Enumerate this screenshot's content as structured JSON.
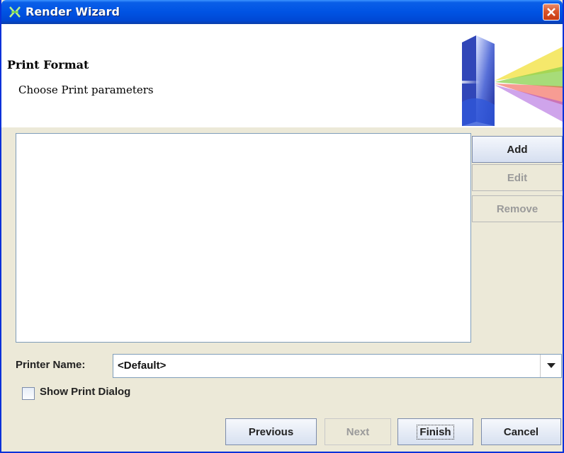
{
  "window": {
    "title": "Render Wizard"
  },
  "header": {
    "title": "Print Format",
    "subtitle": "Choose Print parameters"
  },
  "side_buttons": {
    "add": "Add",
    "edit": "Edit",
    "remove": "Remove"
  },
  "printer": {
    "label": "Printer Name:",
    "value": "<Default>"
  },
  "options": {
    "show_print_dialog_label": "Show Print Dialog",
    "show_print_dialog_checked": false
  },
  "nav": {
    "previous": "Previous",
    "next": "Next",
    "finish": "Finish",
    "cancel": "Cancel"
  },
  "icons": {
    "app": "wizard-icon",
    "close": "close-icon",
    "dropdown": "chevron-down-icon",
    "banner": "prism-icon"
  },
  "colors": {
    "titlebar": "#0053e3",
    "close": "#d9542a",
    "dialog_bg": "#ece9d8"
  }
}
